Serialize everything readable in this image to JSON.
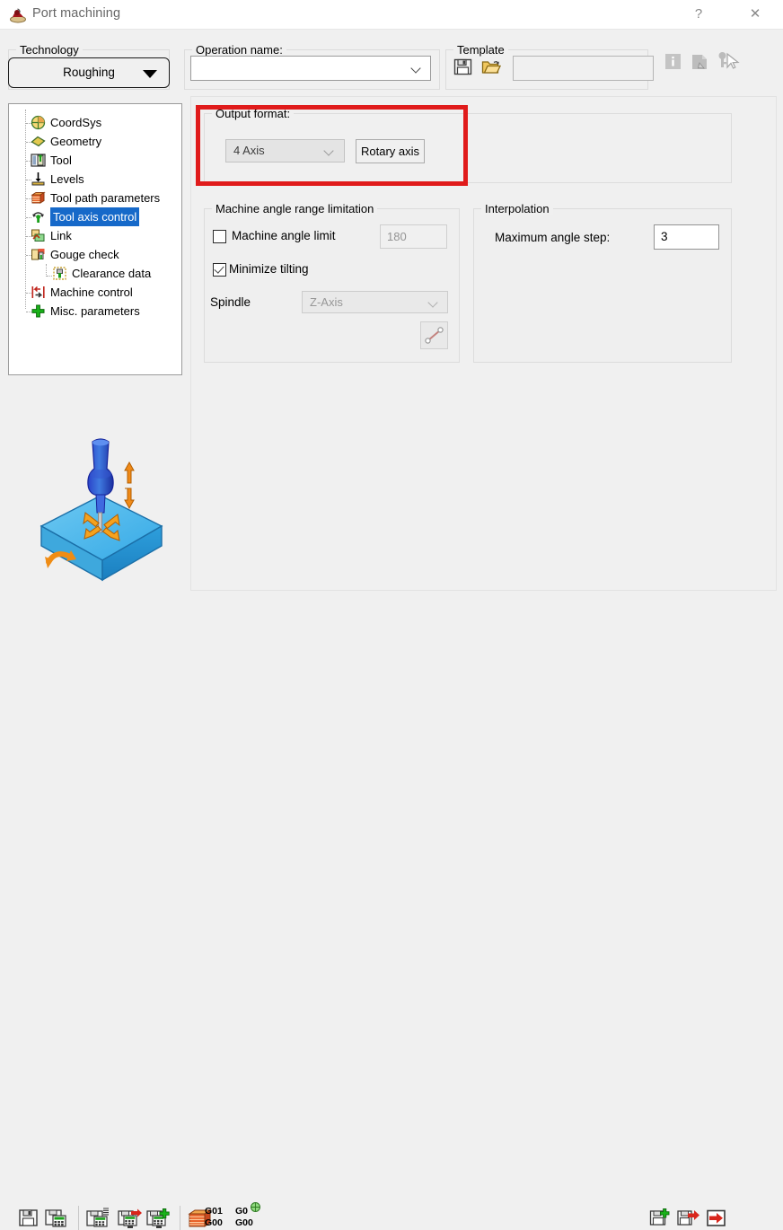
{
  "window": {
    "title": "Port machining",
    "app_icon": "port-machining-icon",
    "help_label": "?",
    "close_label": "✕"
  },
  "technology": {
    "group_label": "Technology",
    "value": "Roughing"
  },
  "operation": {
    "group_label": "Operation name:",
    "value": "",
    "placeholder": ""
  },
  "template": {
    "group_label": "Template",
    "value": "",
    "save_icon": "save-template-icon",
    "open_icon": "open-template-icon",
    "info_icon": "info-icon",
    "doc_icon": "document-icon",
    "key_icon": "key-cursor-icon"
  },
  "tree": {
    "items": [
      {
        "label": "CoordSys",
        "icon": "coordsys-icon",
        "selected": false,
        "child": false
      },
      {
        "label": "Geometry",
        "icon": "geometry-icon",
        "selected": false,
        "child": false
      },
      {
        "label": "Tool",
        "icon": "tool-icon",
        "selected": false,
        "child": false
      },
      {
        "label": "Levels",
        "icon": "levels-icon",
        "selected": false,
        "child": false
      },
      {
        "label": "Tool path parameters",
        "icon": "toolpath-icon",
        "selected": false,
        "child": false
      },
      {
        "label": "Tool axis control",
        "icon": "tool-axis-icon",
        "selected": true,
        "child": false
      },
      {
        "label": "Link",
        "icon": "link-icon",
        "selected": false,
        "child": false
      },
      {
        "label": "Gouge check",
        "icon": "gouge-check-icon",
        "selected": false,
        "child": false
      },
      {
        "label": "Clearance data",
        "icon": "clearance-data-icon",
        "selected": false,
        "child": true
      },
      {
        "label": "Machine control",
        "icon": "machine-control-icon",
        "selected": false,
        "child": false
      },
      {
        "label": "Misc. parameters",
        "icon": "misc-parameters-icon",
        "selected": false,
        "child": false
      }
    ]
  },
  "output_format": {
    "group_label": "Output format:",
    "combo_value": "4 Axis",
    "rotary_button": "Rotary axis",
    "highlight_color": "#e01b1b"
  },
  "machine_angle": {
    "group_label": "Machine angle range limitation",
    "angle_limit_label": "Machine angle limit",
    "angle_limit_checked": false,
    "angle_limit_value": "180",
    "minimize_tilting_label": "Minimize tilting",
    "minimize_tilting_checked": true,
    "spindle_label": "Spindle",
    "spindle_value": "Z-Axis",
    "measure_button_icon": "measure-icon"
  },
  "interpolation": {
    "group_label": "Interpolation",
    "max_step_label": "Maximum angle step:",
    "max_step_value": "3"
  },
  "illustration": {
    "name": "port-machining-illustration"
  },
  "bottom_toolbar": {
    "left_icons": [
      "save-icon",
      "save-calculator-icon",
      "save-list-icon",
      "save-monitor-red-arrow-icon",
      "save-monitor-green-plus-icon",
      "toolpath-stack-icon"
    ],
    "g_labels": [
      {
        "top": "G01",
        "bottom": "G00"
      },
      {
        "top": "G0",
        "bottom": "G00"
      }
    ],
    "right_icons": [
      "save-green-plus-icon",
      "save-red-arrow-icon",
      "exit-red-arrow-icon"
    ]
  }
}
